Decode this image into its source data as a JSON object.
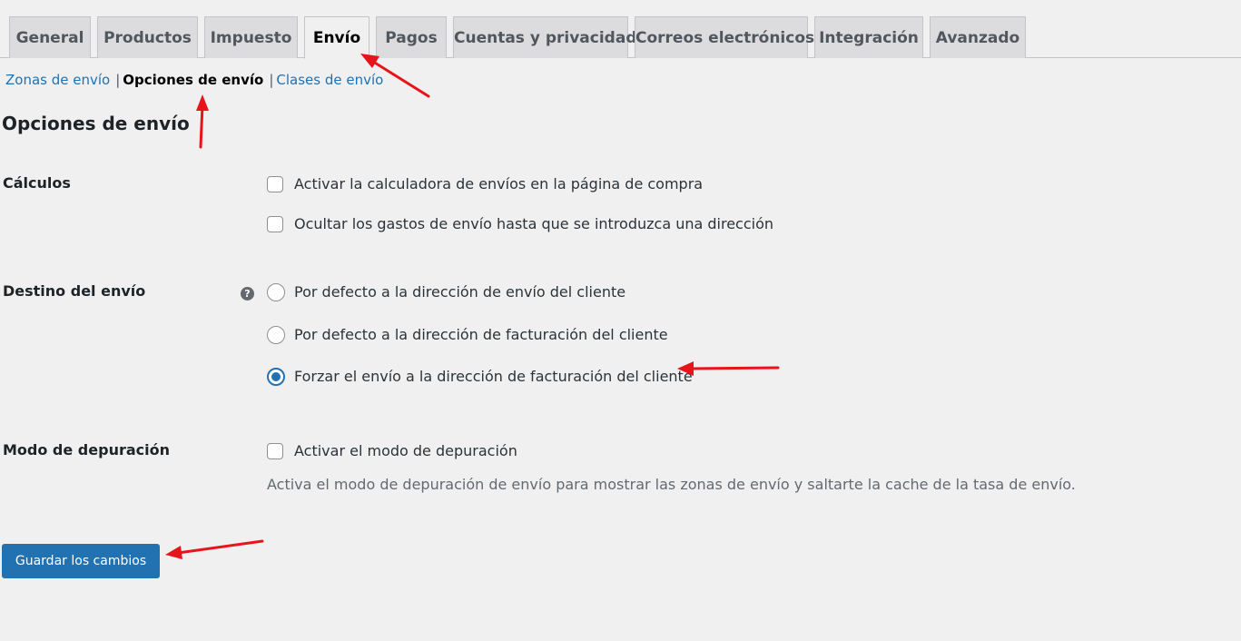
{
  "tabs": [
    {
      "label": "General",
      "active": false
    },
    {
      "label": "Productos",
      "active": false
    },
    {
      "label": "Impuesto",
      "active": false
    },
    {
      "label": "Envío",
      "active": true
    },
    {
      "label": "Pagos",
      "active": false
    },
    {
      "label": "Cuentas y privacidad",
      "active": false
    },
    {
      "label": "Correos electrónicos",
      "active": false
    },
    {
      "label": "Integración",
      "active": false
    },
    {
      "label": "Avanzado",
      "active": false
    }
  ],
  "subnav": {
    "zones": "Zonas de envío",
    "options": "Opciones de envío",
    "classes": "Clases de envío",
    "separator": "|"
  },
  "section_title": "Opciones de envío",
  "calculations": {
    "label": "Cálculos",
    "options": [
      {
        "label": "Activar la calculadora de envíos en la página de compra",
        "checked": false
      },
      {
        "label": "Ocultar los gastos de envío hasta que se introduzca una dirección",
        "checked": false
      }
    ]
  },
  "destination": {
    "label": "Destino del envío",
    "help_icon": "question-circle-icon",
    "help_glyph": "?",
    "options": [
      {
        "label": "Por defecto a la dirección de envío del cliente",
        "checked": false
      },
      {
        "label": "Por defecto a la dirección de facturación del cliente",
        "checked": false
      },
      {
        "label": "Forzar el envío a la dirección de facturación del cliente",
        "checked": true
      }
    ]
  },
  "debug": {
    "label": "Modo de depuración",
    "option": {
      "label": "Activar el modo de depuración",
      "checked": false
    },
    "description": "Activa el modo de depuración de envío para mostrar las zonas de envío y saltarte la cache de la tasa de envío."
  },
  "save_button": "Guardar los cambios",
  "colors": {
    "accent": "#2271b1",
    "annotation_arrow": "#e8141b",
    "background": "#f0f0f1"
  }
}
